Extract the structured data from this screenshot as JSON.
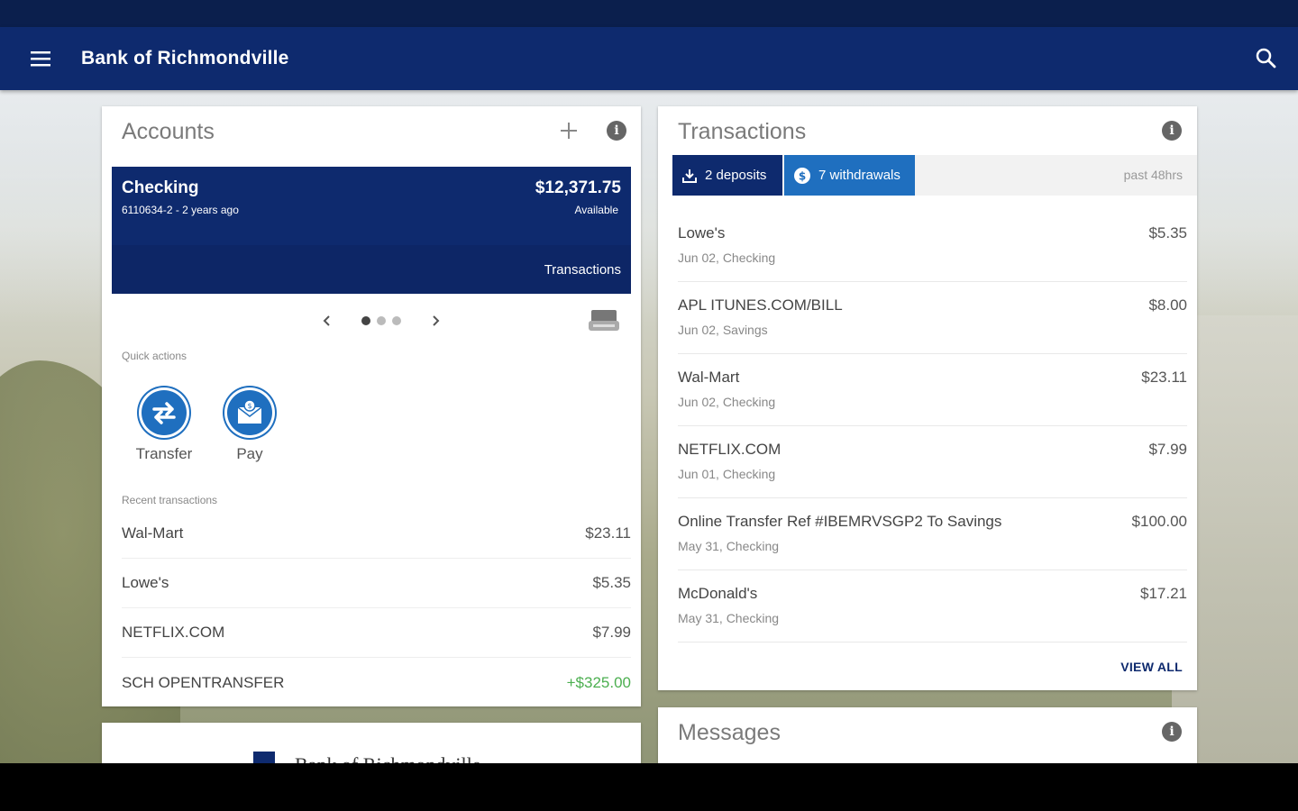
{
  "app": {
    "title": "Bank of Richmondville"
  },
  "accounts": {
    "title": "Accounts",
    "account": {
      "name": "Checking",
      "subtitle": "6110634-2 - 2 years ago",
      "balance": "$12,371.75",
      "balance_label": "Available",
      "transactions_link": "Transactions"
    },
    "pager": {
      "current": 1,
      "total": 3
    },
    "quick_actions_label": "Quick actions",
    "quick_actions": [
      {
        "label": "Transfer",
        "icon": "transfer-icon"
      },
      {
        "label": "Pay",
        "icon": "pay-icon"
      }
    ],
    "recent_label": "Recent transactions",
    "recent": [
      {
        "name": "Wal-Mart",
        "amount": "$23.11"
      },
      {
        "name": "Lowe's",
        "amount": "$5.35"
      },
      {
        "name": "NETFLIX.COM",
        "amount": "$7.99"
      },
      {
        "name": "SCH OPENTRANSFER",
        "amount": "+$325.00"
      }
    ]
  },
  "transactions": {
    "title": "Transactions",
    "tabs": [
      {
        "label": "2 deposits",
        "icon": "download-icon"
      },
      {
        "label": "7 withdrawals",
        "icon": "dollar-icon"
      }
    ],
    "period": "past 48hrs",
    "items": [
      {
        "name": "Lowe's",
        "sub": "Jun 02, Checking",
        "amount": "$5.35"
      },
      {
        "name": "APL ITUNES.COM/BILL",
        "sub": "Jun 02, Savings",
        "amount": "$8.00"
      },
      {
        "name": "Wal-Mart",
        "sub": "Jun 02, Checking",
        "amount": "$23.11"
      },
      {
        "name": "NETFLIX.COM",
        "sub": "Jun 01, Checking",
        "amount": "$7.99"
      },
      {
        "name": "Online Transfer Ref #IBEMRVSGP2 To Savings",
        "sub": "May 31, Checking",
        "amount": "$100.00"
      },
      {
        "name": "McDonald's",
        "sub": "May 31, Checking",
        "amount": "$17.21"
      }
    ],
    "view_all": "VIEW ALL"
  },
  "messages": {
    "title": "Messages"
  },
  "footer": {
    "bank_name": "Bank of Richmondville"
  },
  "colors": {
    "primary": "#0e2a6e",
    "accent": "#1f6fbf",
    "positive": "#4caf50"
  }
}
